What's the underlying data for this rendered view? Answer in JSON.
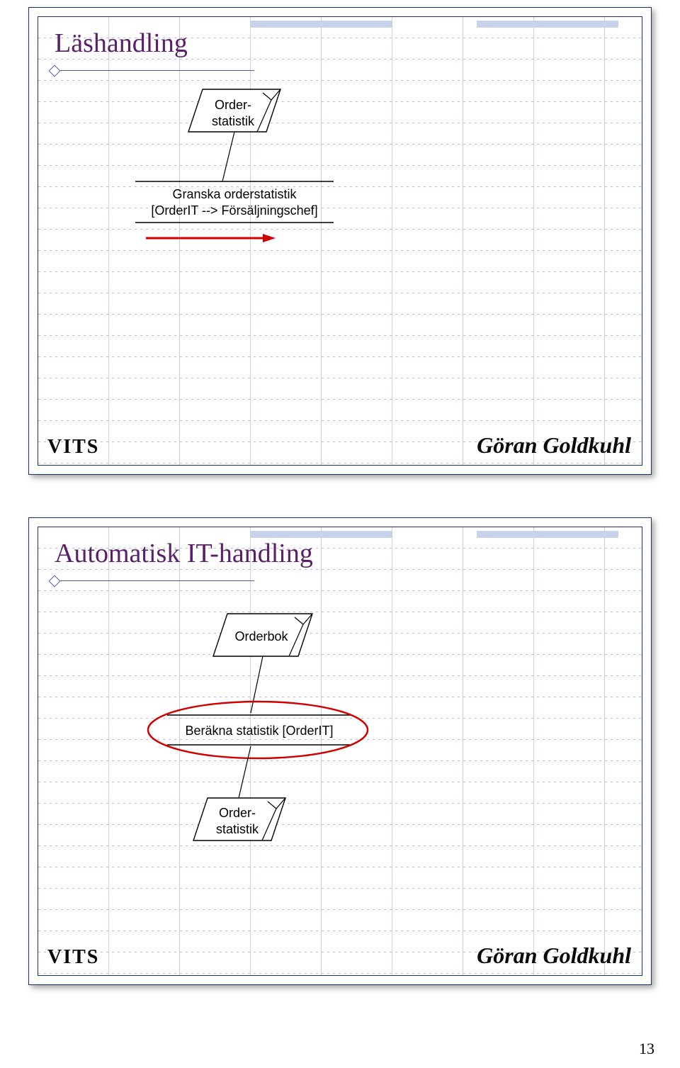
{
  "page_number": "13",
  "slide1": {
    "title": "Läshandling",
    "footer_left": "VITS",
    "footer_right": "Göran Goldkuhl",
    "box1_line1": "Order-",
    "box1_line2": "statistik",
    "process_line1": "Granska orderstatistik",
    "process_line2": "[OrderIT --> Försäljningschef]"
  },
  "slide2": {
    "title": "Automatisk IT-handling",
    "footer_left": "VITS",
    "footer_right": "Göran Goldkuhl",
    "box1": "Orderbok",
    "process": "Beräkna statistik [OrderIT]",
    "box2_line1": "Order-",
    "box2_line2": "statistik"
  }
}
